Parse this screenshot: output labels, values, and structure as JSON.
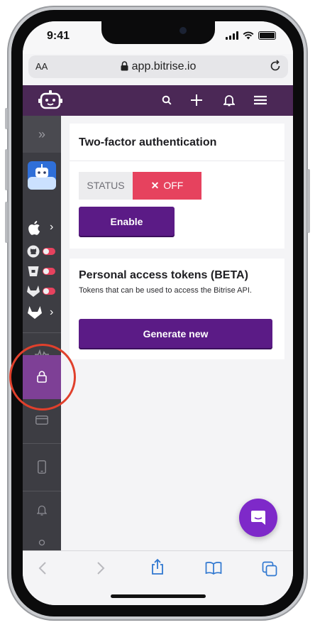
{
  "status_bar": {
    "time": "9:41"
  },
  "browser": {
    "text_size_label": "AA",
    "url": "app.bitrise.io"
  },
  "sidebar": {
    "items": [
      "collapse",
      "app-avatar",
      "apple",
      "github",
      "bitbucket",
      "gitlab",
      "gitlab-2",
      "activity",
      "security",
      "billing",
      "devices",
      "notifications"
    ]
  },
  "two_factor": {
    "title": "Two-factor authentication",
    "status_label": "STATUS",
    "status_value": "OFF",
    "enable_label": "Enable"
  },
  "tokens": {
    "title": "Personal access tokens (BETA)",
    "description": "Tokens that can be used to access the Bitrise API.",
    "generate_label": "Generate new"
  },
  "colors": {
    "header": "#4b2856",
    "primary_button": "#5b1b86",
    "status_off": "#e6425e",
    "sidebar": "#3d3d43",
    "sidebar_active": "#7e4096",
    "chat": "#7e29c9",
    "annotation": "#e0402c"
  }
}
